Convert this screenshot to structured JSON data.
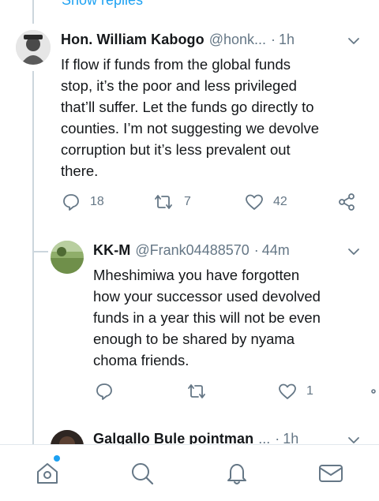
{
  "show_replies": "Show replies",
  "tweets": [
    {
      "name": "Hon. William Kabogo",
      "handle": "@honk...",
      "dot": "·",
      "time": "1h",
      "lines": [
        "If flow if funds from the global funds",
        "stop, it’s the poor and less privileged",
        "that’ll suffer. Let the funds go directly to",
        "counties. I’m not suggesting we devolve",
        "corruption but it’s less prevalent out",
        "there."
      ],
      "replies": "18",
      "retweets": "7",
      "likes": "42"
    },
    {
      "name": "KK-M",
      "handle": "@Frank04488570",
      "dot": "·",
      "time": "44m",
      "lines": [
        "Mheshimiwa you have forgotten",
        "how your successor used devolved",
        "funds in a year this will not be even",
        "enough to be shared by nyama",
        "choma friends."
      ],
      "replies": "",
      "retweets": "",
      "likes": "1"
    },
    {
      "name": "Galgallo Bule pointman",
      "handle": "...",
      "dot": "·",
      "time": "1h"
    }
  ],
  "nav": {
    "items": [
      "home-icon",
      "search-icon",
      "notifications-icon",
      "messages-icon"
    ],
    "accent": "#1da1f2"
  }
}
